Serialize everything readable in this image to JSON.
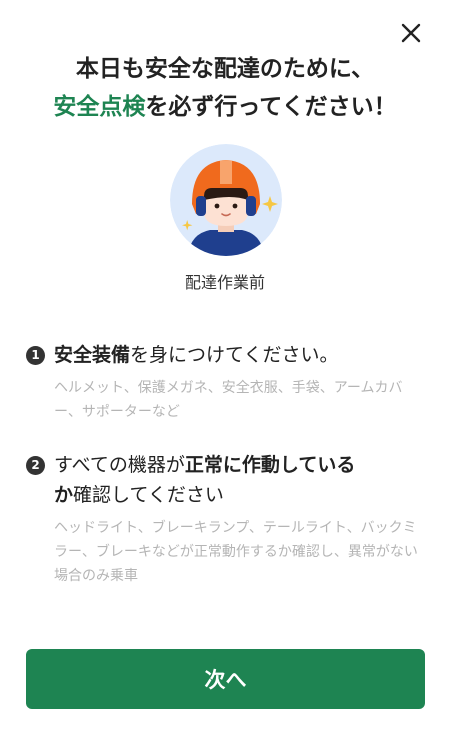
{
  "dialog": {
    "close_icon": "close-icon",
    "headline": {
      "line1": "本日も安全な配達のために、",
      "line2_accent": "安全点検",
      "line2_rest": "を必ず行ってください！"
    },
    "avatar": {
      "icon": "helmet-rider-avatar",
      "caption": "配達作業前"
    },
    "steps": [
      {
        "number": "1",
        "title_bold": "安全装備",
        "title_rest": "を身につけてください。",
        "description": "ヘルメット、保護メガネ、安全衣服、手袋、アームカバー、サポーターなど"
      },
      {
        "number": "2",
        "title_plain_1": "すべての機器が",
        "title_bold_1": "正常に作動している",
        "title_bold_2": "か",
        "title_plain_2": "確認してください",
        "description": "ヘッドライト、ブレーキランプ、テールライト、バックミラー、ブレーキなどが正常動作するか確認し、異常がない場合のみ乗車"
      }
    ],
    "next_button_label": "次へ",
    "colors": {
      "accent": "#1e8452",
      "helmet": "#f06a1d",
      "avatar_bg": "#dce9fb",
      "text_muted": "#b5b5b5"
    }
  }
}
